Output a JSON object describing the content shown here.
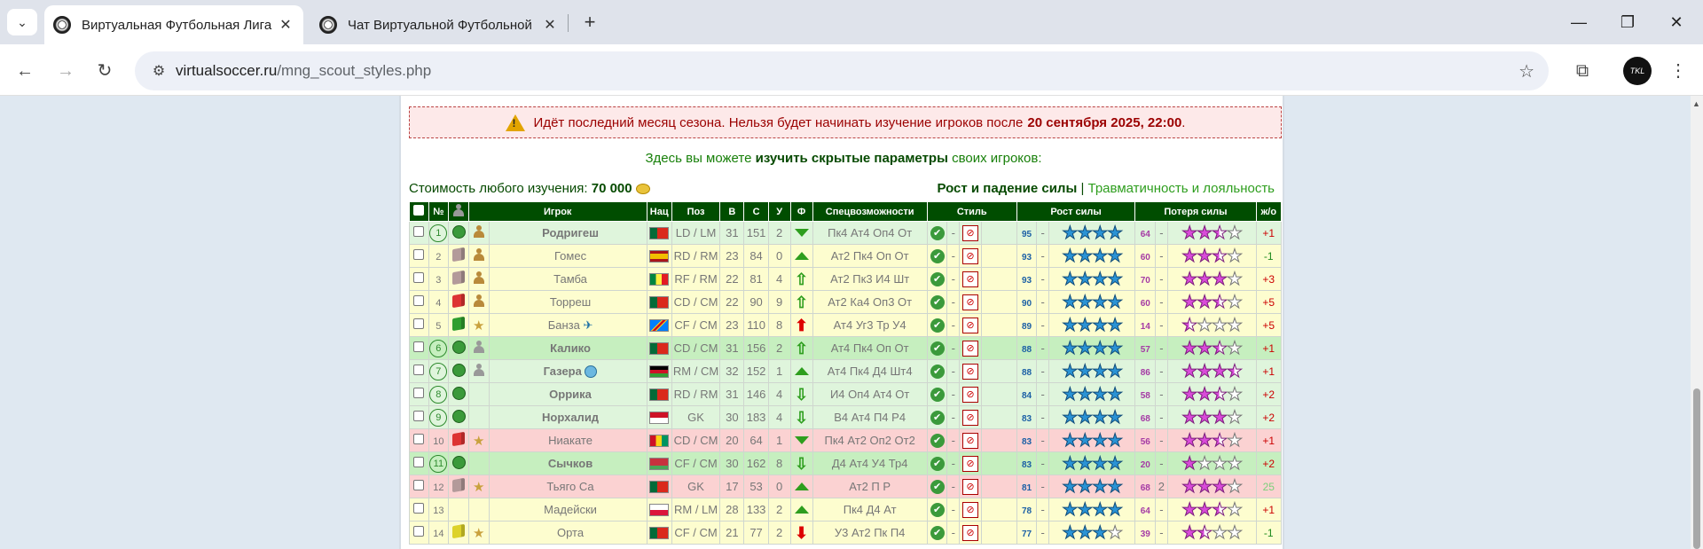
{
  "browser": {
    "tabs": [
      {
        "title": "Виртуальная Футбольная Лига",
        "active": true
      },
      {
        "title": "Чат Виртуальной Футбольной",
        "active": false
      }
    ],
    "url_host": "virtualsoccer.ru",
    "url_path": "/mng_scout_styles.php",
    "profile": "TKL"
  },
  "notice": {
    "text": "Идёт последний месяц сезона. Нельзя будет начинать изучение игроков после",
    "deadline": "20 сентября 2025, 22:00",
    "end": "."
  },
  "intro": {
    "before": "Здесь вы можете",
    "bold": "изучить скрытые параметры",
    "after": "своих игроков:"
  },
  "cost": {
    "label": "Стоимость любого изучения:",
    "value": "70 000"
  },
  "links": {
    "active": "Рост и падение силы",
    "sep": "|",
    "other": "Травматичность и лояльность"
  },
  "table": {
    "headers": [
      "№",
      "Игрок",
      "Нац",
      "Поз",
      "В",
      "С",
      "У",
      "Ф",
      "Спецвозможности",
      "Стиль",
      "Рост силы",
      "Потеря силы",
      "ж/о"
    ],
    "rows": [
      {
        "n": "1",
        "circle": true,
        "cube": "ball",
        "icon": "person",
        "name": "Родригеш",
        "bold": true,
        "flag": "pt",
        "pos": "LD / LM",
        "age": "31",
        "str": "151",
        "u": "2",
        "form": "down-small",
        "spec": "Пк4 Ат4 Оп4 От",
        "dash": "-",
        "growth": "95",
        "gstars": 4,
        "lvl": "",
        "loss": "64",
        "lstars": [
          1,
          1,
          0.5,
          0
        ],
        "delta": "+1",
        "dcls": "plus",
        "cls": "g"
      },
      {
        "n": "2",
        "circle": false,
        "cube": "grey",
        "icon": "person",
        "name": "Гомес",
        "bold": false,
        "flag": "es",
        "pos": "RD / RM",
        "age": "23",
        "str": "84",
        "u": "0",
        "form": "up-small",
        "spec": "Ат2 Пк4 Оп От",
        "dash": "-",
        "growth": "93",
        "gstars": 4,
        "lvl": "",
        "loss": "60",
        "lstars": [
          1,
          1,
          0.5,
          0
        ],
        "delta": "-1",
        "dcls": "minus",
        "cls": "y"
      },
      {
        "n": "3",
        "circle": false,
        "cube": "grey",
        "icon": "person",
        "name": "Тамба",
        "bold": false,
        "flag": "sn",
        "pos": "RF / RM",
        "age": "22",
        "str": "81",
        "u": "4",
        "form": "up",
        "spec": "Ат2 Пк3 И4 Шт",
        "dash": "-",
        "growth": "93",
        "gstars": 4,
        "lvl": "",
        "loss": "70",
        "lstars": [
          1,
          1,
          1,
          0
        ],
        "delta": "+3",
        "dcls": "plus",
        "cls": "y"
      },
      {
        "n": "4",
        "circle": false,
        "cube": "red",
        "icon": "person",
        "name": "Торреш",
        "bold": false,
        "flag": "pt",
        "pos": "CD / CM",
        "age": "22",
        "str": "90",
        "u": "9",
        "form": "up",
        "spec": "Ат2 Ка4 Оп3 От",
        "dash": "-",
        "growth": "90",
        "gstars": 4,
        "lvl": "",
        "loss": "60",
        "lstars": [
          1,
          1,
          0.5,
          0
        ],
        "delta": "+5",
        "dcls": "plus",
        "cls": "y"
      },
      {
        "n": "5",
        "circle": false,
        "cube": "green",
        "icon": "star",
        "name": "Банза",
        "bold": false,
        "flag": "cd",
        "pos": "CF / CM",
        "age": "23",
        "str": "110",
        "u": "8",
        "form": "up-red",
        "spec": "Ат4 Уг3 Тр У4",
        "dash": "-",
        "growth": "89",
        "gstars": 4,
        "lvl": "",
        "loss": "14",
        "lstars": [
          0.5,
          0,
          0,
          0
        ],
        "delta": "+5",
        "dcls": "plus",
        "cls": "y",
        "plane": true
      },
      {
        "n": "6",
        "circle": true,
        "cube": "ball",
        "icon": "person-grey",
        "name": "Калико",
        "bold": true,
        "flag": "pt",
        "pos": "CD / CM",
        "age": "31",
        "str": "156",
        "u": "2",
        "form": "up",
        "spec": "Ат4 Пк4 Оп От",
        "dash": "-",
        "growth": "88",
        "gstars": 4,
        "lvl": "",
        "loss": "57",
        "lstars": [
          1,
          1,
          0.5,
          0
        ],
        "delta": "+1",
        "dcls": "plus",
        "cls": "gb"
      },
      {
        "n": "7",
        "circle": true,
        "cube": "ball",
        "icon": "person-grey",
        "name": "Газера",
        "bold": true,
        "flag": "mw",
        "pos": "RM / CM",
        "age": "32",
        "str": "152",
        "u": "1",
        "form": "up-small",
        "spec": "Ат4 Пк4 Д4 Шт4",
        "dash": "-",
        "growth": "88",
        "gstars": 4,
        "lvl": "",
        "loss": "86",
        "lstars": [
          1,
          1,
          1,
          0.5
        ],
        "delta": "+1",
        "dcls": "plus",
        "cls": "g",
        "globe": true
      },
      {
        "n": "8",
        "circle": true,
        "cube": "ball",
        "icon": "",
        "name": "Оррика",
        "bold": true,
        "flag": "pt",
        "pos": "RD / RM",
        "age": "31",
        "str": "146",
        "u": "4",
        "form": "down",
        "spec": "И4 Оп4 Ат4 От",
        "dash": "-",
        "growth": "84",
        "gstars": 4,
        "lvl": "",
        "loss": "58",
        "lstars": [
          1,
          1,
          0.5,
          0
        ],
        "delta": "+2",
        "dcls": "plus",
        "cls": "g"
      },
      {
        "n": "9",
        "circle": true,
        "cube": "ball",
        "icon": "",
        "name": "Норхалид",
        "bold": true,
        "flag": "id",
        "pos": "GK",
        "age": "30",
        "str": "183",
        "u": "4",
        "form": "down",
        "spec": "В4 Ат4 П4 Р4",
        "dash": "-",
        "growth": "83",
        "gstars": 4,
        "lvl": "",
        "loss": "68",
        "lstars": [
          1,
          1,
          1,
          0
        ],
        "delta": "+2",
        "dcls": "plus",
        "cls": "g"
      },
      {
        "n": "10",
        "circle": false,
        "cube": "red",
        "icon": "star",
        "name": "Ниакате",
        "bold": false,
        "flag": "gn",
        "pos": "CD / CM",
        "age": "20",
        "str": "64",
        "u": "1",
        "form": "down-small",
        "spec": "Пк4 Ат2 Оп2 От2",
        "dash": "-",
        "growth": "83",
        "gstars": 4,
        "lvl": "",
        "loss": "56",
        "lstars": [
          1,
          1,
          0.5,
          0
        ],
        "delta": "+1",
        "dcls": "plus",
        "cls": "r"
      },
      {
        "n": "11",
        "circle": true,
        "cube": "ball",
        "icon": "",
        "name": "Сычков",
        "bold": true,
        "flag": "by",
        "pos": "CF / CM",
        "age": "30",
        "str": "162",
        "u": "8",
        "form": "down",
        "spec": "Д4 Ат4 У4 Тр4",
        "dash": "-",
        "growth": "83",
        "gstars": 4,
        "lvl": "",
        "loss": "20",
        "lstars": [
          1,
          0,
          0,
          0
        ],
        "delta": "+2",
        "dcls": "plus",
        "cls": "gb"
      },
      {
        "n": "12",
        "circle": false,
        "cube": "grey",
        "icon": "star",
        "name": "Тьяго Са",
        "bold": false,
        "flag": "pt",
        "pos": "GK",
        "age": "17",
        "str": "53",
        "u": "0",
        "form": "up-small",
        "spec": "Ат2 П Р",
        "dash": "-",
        "growth": "81",
        "gstars": 4,
        "lvl": "2",
        "loss": "68",
        "lstars": [
          1,
          1,
          1,
          0
        ],
        "delta": "25",
        "dcls": "greenv",
        "cls": "r"
      },
      {
        "n": "13",
        "circle": false,
        "cube": "",
        "icon": "",
        "name": "Мадейски",
        "bold": false,
        "flag": "pl",
        "pos": "RM / LM",
        "age": "28",
        "str": "133",
        "u": "2",
        "form": "up-small",
        "spec": "Пк4 Д4 Ат",
        "dash": "-",
        "growth": "78",
        "gstars": 4,
        "lvl": "",
        "loss": "64",
        "lstars": [
          1,
          1,
          0.5,
          0
        ],
        "delta": "+1",
        "dcls": "plus",
        "cls": "y"
      },
      {
        "n": "14",
        "circle": false,
        "cube": "yellow",
        "icon": "star",
        "name": "Орта",
        "bold": false,
        "flag": "pt",
        "pos": "CF / CM",
        "age": "21",
        "str": "77",
        "u": "2",
        "form": "down-red",
        "spec": "У3 Ат2 Пк П4",
        "dash": "-",
        "growth": "77",
        "gstars": 3,
        "lvl": "",
        "loss": "39",
        "lstars": [
          1,
          0.5,
          0,
          0
        ],
        "delta": "-1",
        "dcls": "minus",
        "cls": "y"
      }
    ]
  },
  "colors": {
    "header_bg": "#004d00",
    "row_green": "#dff5dc",
    "row_yellow": "#fdfdcf",
    "row_red": "#fbd2d2",
    "warn_bg": "#fde9e9"
  },
  "icons": [
    "chevron-down-icon",
    "soccer-ball-favicon",
    "close-icon",
    "plus-icon",
    "minimize-icon",
    "restore-icon",
    "back-icon",
    "forward-icon",
    "reload-icon",
    "site-info-icon",
    "bookmark-star-icon",
    "extensions-icon",
    "menu-kebab-icon",
    "warning-icon",
    "coin-icon",
    "cube-icon",
    "person-icon",
    "star-icon",
    "plane-icon",
    "globe-icon",
    "check-icon",
    "style-icon"
  ]
}
